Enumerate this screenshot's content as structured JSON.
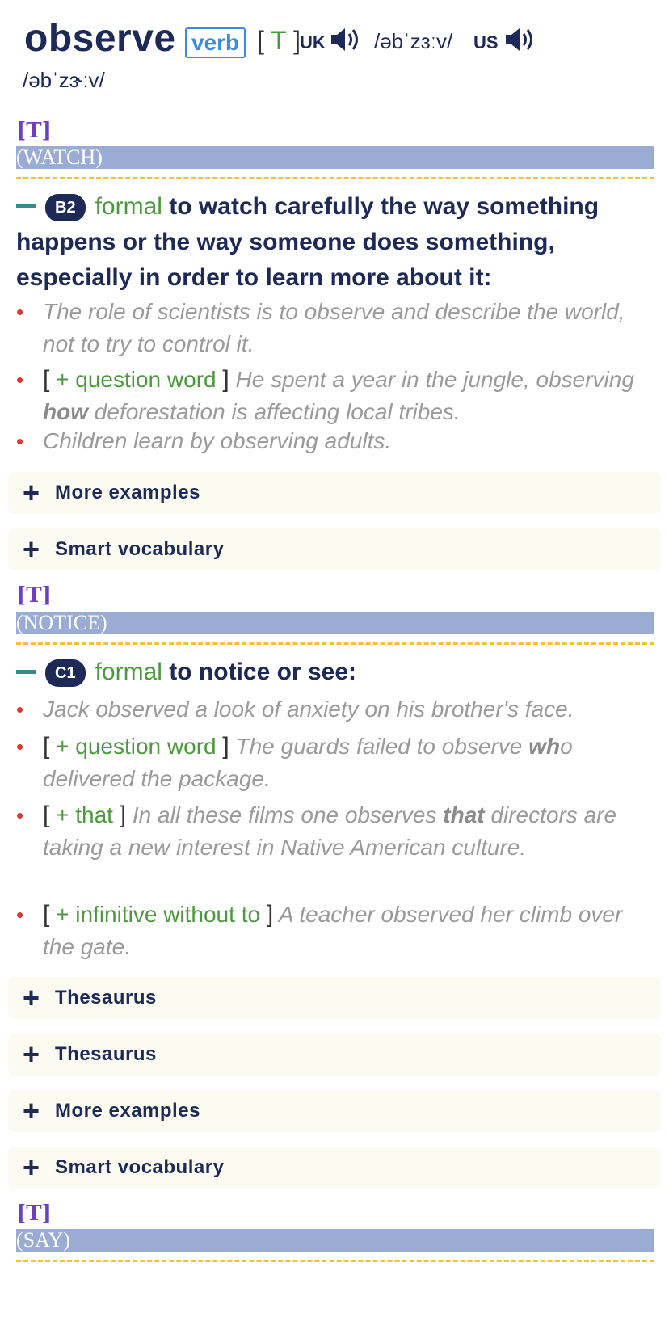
{
  "entry": {
    "headword": "observe",
    "pos": "verb",
    "grammar": "T",
    "uk_label": "UK",
    "uk_pron": "/əbˈzɜːv/",
    "us_label": "US",
    "us_pron": "/əbˈzɝːv/",
    "speaker_icon": "speaker-icon"
  },
  "senses": [
    {
      "gram": "[T]",
      "guideword": "(WATCH)",
      "level": "B2",
      "register": "formal",
      "definition": "to watch carefully the way something happens or the way someone does something, especially in order to learn more about it:",
      "examples": [
        {
          "text": "The role of scientists is to observe and describe the world, not to try to control it."
        },
        {
          "gram_open": "[",
          "gram": "+ question word",
          "gram_close": "]",
          "pre": "He spent a year in the jungle, observing ",
          "bold": "how",
          "post": " deforestation is affecting local tribes."
        },
        {
          "text": "Children learn by observing adults."
        }
      ],
      "accordions": [
        "More examples",
        "Smart vocabulary"
      ]
    },
    {
      "gram": "[T]",
      "guideword": "(NOTICE)",
      "level": "C1",
      "register": "formal",
      "definition": "to notice or see:",
      "examples": [
        {
          "text": "Jack observed a look of anxiety on his brother's face."
        },
        {
          "gram_open": "[",
          "gram": "+ question word",
          "gram_close": "]",
          "pre": "The guards failed to observe ",
          "bold": "wh",
          "post": "o delivered the package."
        },
        {
          "gram_open": "[",
          "gram": "+ that",
          "gram_close": "]",
          "pre": "In all these films one observes ",
          "bold": "that",
          "post": " directors are taking a new interest in Native American culture."
        },
        {
          "gram_open": "[",
          "gram": "+ infinitive without to",
          "gram_close": "]",
          "pre": "A teacher observed her climb over the gate.",
          "bold": "",
          "post": ""
        }
      ],
      "accordions": [
        "Thesaurus",
        "Thesaurus",
        "More examples",
        "Smart vocabulary"
      ]
    },
    {
      "gram": "[T]",
      "guideword": "(SAY)"
    }
  ],
  "accordion_icon": "+",
  "bullet": "•",
  "colors": {
    "headword": "#1d2a57",
    "pos_border": "#3c8de0",
    "guideword_bg": "#9aacd4",
    "dashed_rule": "#f0c23a",
    "register": "#4a9a3c",
    "bullet": "#e0362c",
    "gram_label": "#6a3fc4"
  }
}
